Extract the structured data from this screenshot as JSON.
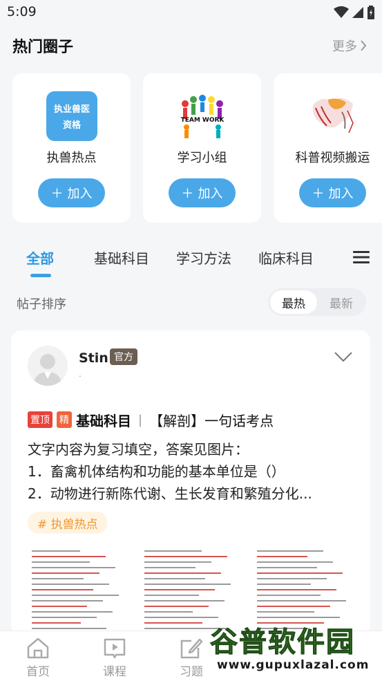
{
  "status_bar": {
    "time": "5:09"
  },
  "circles_section": {
    "title": "热门圈子",
    "more_label": "更多",
    "circles": [
      {
        "name": "执兽热点",
        "avatar_text_line1": "执业兽医",
        "avatar_text_line2": "资格",
        "join_label": "加入"
      },
      {
        "name": "学习小组",
        "avatar_text": "TEAM WORK",
        "join_label": "加入"
      },
      {
        "name": "科普视频搬运",
        "join_label": "加入"
      }
    ]
  },
  "tabs": {
    "items": [
      "全部",
      "基础科目",
      "学习方法",
      "临床科目"
    ],
    "active_index": 0,
    "accent_color": "#2d9ae0"
  },
  "sort_bar": {
    "label": "帖子排序",
    "options": [
      "最热",
      "最新"
    ],
    "selected": "最热"
  },
  "post": {
    "author": "Stin",
    "author_badge": "官方",
    "author_subtext": ".",
    "tag_top": "置顶",
    "tag_elite": "精",
    "category": "基础科目",
    "separator": "|",
    "title": "【解剖】一句话考点",
    "body_lines": [
      "文字内容为复习填空，答案见图片：",
      "1．畜禽机体结构和功能的基本单位是（）",
      "2．动物进行新陈代谢、生长发育和繁殖分化..."
    ],
    "topic_tag": "# 执兽热点"
  },
  "bottom_nav": {
    "items": [
      {
        "label": "首页",
        "icon": "home-icon"
      },
      {
        "label": "课程",
        "icon": "play-book-icon"
      },
      {
        "label": "习题",
        "icon": "edit-icon"
      }
    ]
  },
  "watermark": {
    "text": "谷普软件园",
    "url": "www.gupuxlazal.com"
  }
}
